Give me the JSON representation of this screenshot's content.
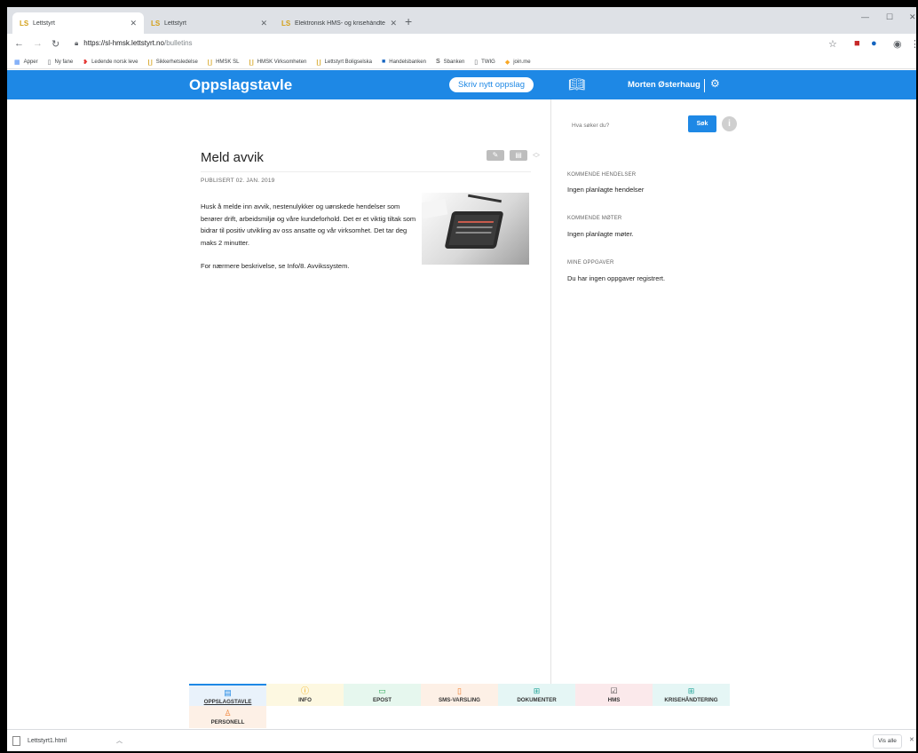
{
  "browser": {
    "tabs": [
      {
        "title": "Lettstyrt",
        "favicon": "LS"
      },
      {
        "title": "Lettstyrt",
        "favicon": "LS"
      },
      {
        "title": "Elektronisk HMS- og krisehåndte",
        "favicon": "LS"
      }
    ],
    "new_tab": "+",
    "url_host": "https://sl-hmsk.lettstyrt.no",
    "url_path": "/bulletins",
    "bookmarks": [
      {
        "label": "Apper",
        "icon": "apps-grid-icon"
      },
      {
        "label": "Ny fane",
        "icon": "page-icon"
      },
      {
        "label": "Ledende norsk leve",
        "icon": "logo-icon"
      },
      {
        "label": "Sikkerhetsledelse",
        "icon": "lettstyrt-icon"
      },
      {
        "label": "HMSK SL",
        "icon": "lettstyrt-icon"
      },
      {
        "label": "HMSK Virksomheten",
        "icon": "lettstyrt-icon"
      },
      {
        "label": "Lettstyrt Boligselska",
        "icon": "lettstyrt-icon"
      },
      {
        "label": "Handelsbanken",
        "icon": "bank-icon"
      },
      {
        "label": "Sbanken",
        "icon": "bank-icon"
      },
      {
        "label": "TWIG",
        "icon": "page-icon"
      },
      {
        "label": "join.me",
        "icon": "joinme-icon"
      }
    ]
  },
  "header": {
    "title": "Oppslagstavle",
    "write_button": "Skriv nytt oppslag",
    "user_name": "Morten Østerhaug"
  },
  "post": {
    "title": "Meld avvik",
    "published": "PUBLISERT 02. JAN. 2019",
    "paragraphs": [
      "Husk å melde inn avvik, nestenulykker og uønskede hendelser som berører drift, arbeidsmiljø og våre kundeforhold. Det er et viktig tiltak som bidrar til positiv utvikling av oss ansatte og vår virksomhet. Det tar deg maks 2 minutter.",
      "For nærmere beskrivelse, se Info/8. Avvikssystem."
    ]
  },
  "sidebar": {
    "search_placeholder": "Hva søker du?",
    "search_button": "Søk",
    "sections": [
      {
        "heading": "KOMMENDE HENDELSER",
        "text": "Ingen planlagte hendelser"
      },
      {
        "heading": "KOMMENDE MØTER",
        "text": "Ingen planlagte møter."
      },
      {
        "heading": "MINE OPPGAVER",
        "text": "Du har ingen oppgaver registrert."
      }
    ]
  },
  "bottom_nav": [
    {
      "label": "OPPSLAGSTAVLE",
      "icon": "bulletin-icon",
      "color": "#1e88e5",
      "active": true
    },
    {
      "label": "INFO",
      "icon": "info-icon",
      "color": "#f0a500"
    },
    {
      "label": "EPOST",
      "icon": "chat-icon",
      "color": "#2eaa5a"
    },
    {
      "label": "SMS-VARSLING",
      "icon": "phone-icon",
      "color": "#f07c2c"
    },
    {
      "label": "DOKUMENTER",
      "icon": "documents-icon",
      "color": "#26a69a"
    },
    {
      "label": "HMS",
      "icon": "checklist-icon",
      "color": "#444444"
    },
    {
      "label": "KRISEHÅNDTERING",
      "icon": "crisis-icon",
      "color": "#26a69a"
    },
    {
      "label": "PERSONELL",
      "icon": "person-icon",
      "color": "#f07c2c"
    }
  ],
  "downloads": {
    "file": "Lettstyrt1.html",
    "show_all": "Vis alle"
  },
  "colors": {
    "accent": "#1e88e5"
  }
}
